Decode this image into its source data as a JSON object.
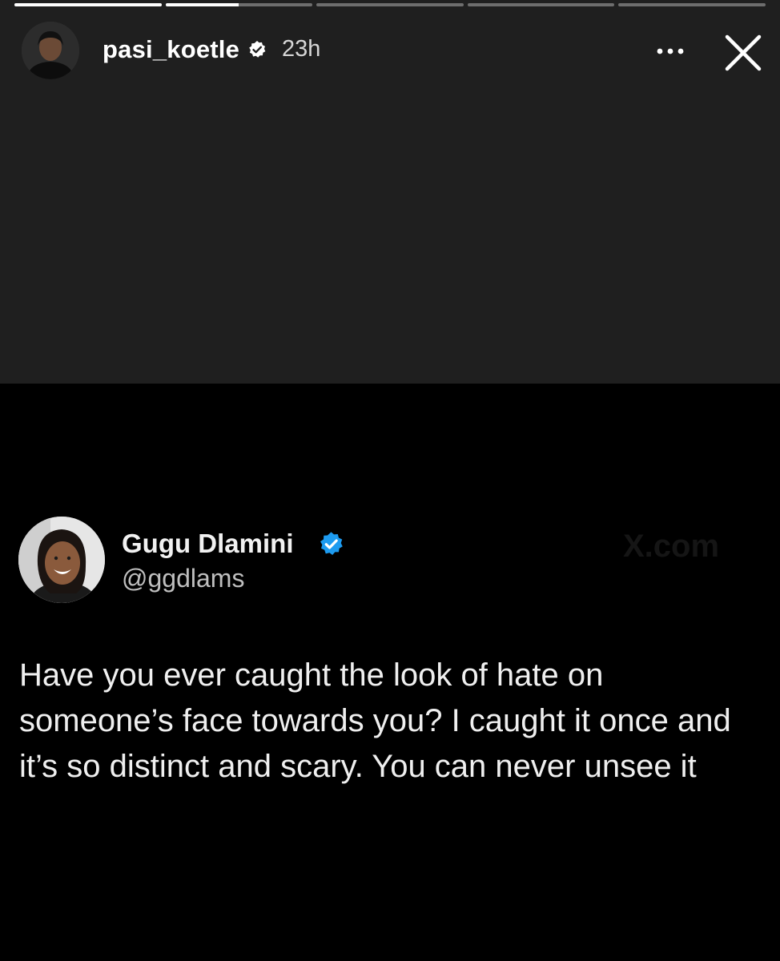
{
  "story": {
    "progress": [
      1.0,
      0.5,
      0.0,
      0.0,
      0.0
    ],
    "username": "pasi_koetle",
    "time_ago": "23h",
    "more_label": "•••",
    "close_icon": "close-icon",
    "verified_icon": "verified-badge-icon"
  },
  "tweet": {
    "display_name": "Gugu Dlamini",
    "handle": "@ggdlams",
    "watermark": "X.com",
    "verified_color": "#1d9bf0",
    "text_lines": [
      "Have you ever caught the look of hate on",
      "someone’s face towards you? I caught it once and",
      "it’s so distinct and scary. You can never unsee it"
    ]
  },
  "colors": {
    "story_background": "#1f1f1f",
    "post_background": "#000000"
  }
}
